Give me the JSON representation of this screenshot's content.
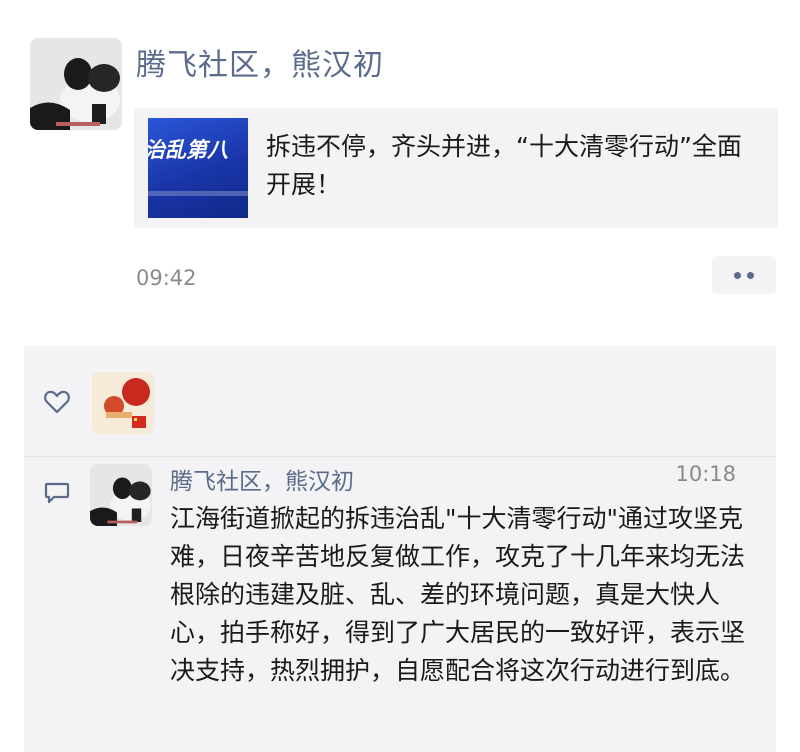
{
  "post": {
    "author": "腾飞社区，熊汉初",
    "share_card": {
      "thumbnail_text": "治乱第八",
      "title": "拆违不停，齐头并进，“十大清零行动”全面开展！"
    },
    "time": "09:42",
    "more_icon": "more-dots-icon"
  },
  "interactions": {
    "like_icon": "heart-icon",
    "comment_icon": "comment-bubble-icon",
    "comments": [
      {
        "author": "腾飞社区，熊汉初",
        "time": "10:18",
        "text": "江海街道掀起的拆违治乱\"十大清零行动\"通过攻坚克难，日夜辛苦地反复做工作，攻克了十几年来均无法根除的违建及脏、乱、差的环境问题，真是大快人心，拍手称好，得到了广大居民的一致好评，表示坚决支持，热烈拥护，自愿配合将这次行动进行到底。"
      }
    ]
  },
  "colors": {
    "name_link": "#5a6b8c",
    "meta_gray": "#8a8a8a",
    "panel_bg": "#f3f3f5"
  }
}
